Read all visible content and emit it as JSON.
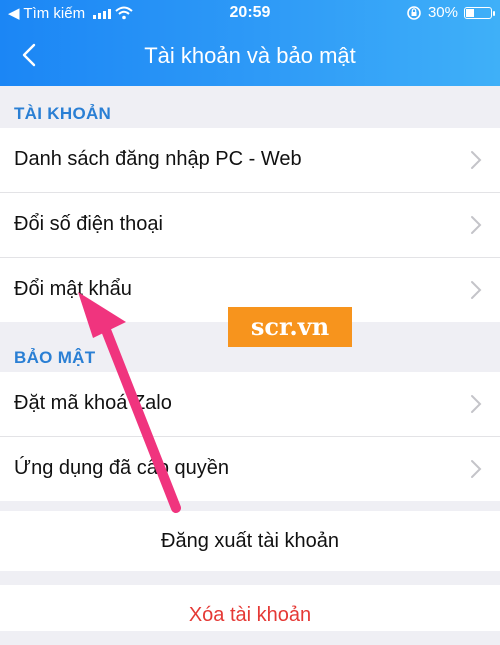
{
  "status_bar": {
    "carrier": "◀ Tìm kiếm",
    "time": "20:59",
    "battery": "30%",
    "icons": [
      "signal-icon",
      "wifi-icon",
      "rotation-lock-icon",
      "battery-icon"
    ]
  },
  "nav": {
    "title": "Tài khoản và bảo mật",
    "back_icon": "back-chevron-icon"
  },
  "account_section": {
    "header": "TÀI KHOẢN",
    "items": [
      {
        "label": "Danh sách đăng nhập PC - Web"
      },
      {
        "label": "Đổi số điện thoại"
      },
      {
        "label": "Đổi mật khẩu"
      }
    ]
  },
  "security_section": {
    "header": "BẢO MẬT",
    "items": [
      {
        "label": "Đặt mã khoá Zalo"
      },
      {
        "label": "Ứng dụng đã cấp quyền"
      }
    ]
  },
  "actions": {
    "logout": "Đăng xuất tài khoản",
    "delete": "Xóa tài khoản"
  },
  "watermark": "scr.vn",
  "colors": {
    "header_gradient_start": "#1b86f5",
    "header_gradient_end": "#3fb0f8",
    "section_header": "#2a7fd4",
    "danger": "#e53935",
    "annotation_arrow": "#f0347e",
    "watermark_bg": "#f7941d"
  }
}
